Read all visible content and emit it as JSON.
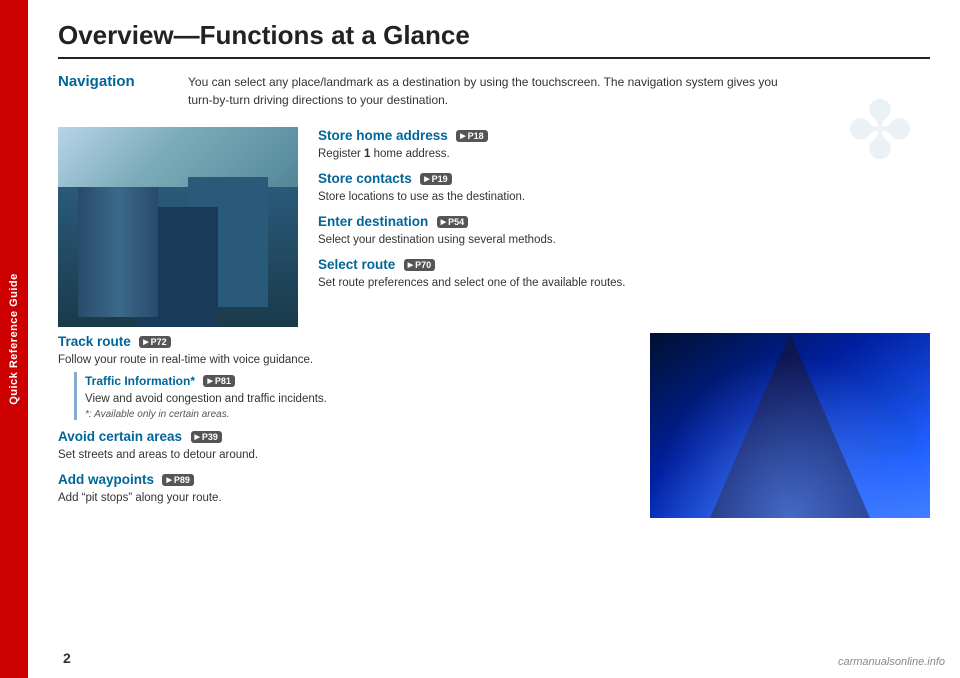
{
  "sidebar": {
    "label": "Quick Reference Guide"
  },
  "page": {
    "title": "Overview—Functions at a Glance",
    "number": "2"
  },
  "navigation": {
    "label": "Navigation",
    "description_line1": "You can select any place/landmark as a destination by using the touchscreen. The navigation system gives you",
    "description_line2": "turn-by-turn driving directions to your destination."
  },
  "features": [
    {
      "title": "Store home address",
      "page_ref": "P18",
      "description": "Register 1 home address."
    },
    {
      "title": "Store contacts",
      "page_ref": "P19",
      "description": "Store locations to use as the destination."
    },
    {
      "title": "Enter destination",
      "page_ref": "P54",
      "description": "Select your destination using several methods."
    },
    {
      "title": "Select route",
      "page_ref": "P70",
      "description": "Set route preferences and select one of the available routes."
    }
  ],
  "lower_features": [
    {
      "title": "Track route",
      "page_ref": "P72",
      "description": "Follow your route in real-time with voice guidance.",
      "sub_feature": {
        "title": "Traffic Information*",
        "page_ref": "P81",
        "description": "View and avoid congestion and traffic incidents.",
        "note": "*: Available only in certain areas."
      }
    },
    {
      "title": "Avoid certain areas",
      "page_ref": "P39",
      "description": "Set streets and areas to detour around."
    },
    {
      "title": "Add waypoints",
      "page_ref": "P89",
      "description": "Add “pit stops” along your route."
    }
  ],
  "watermark": "carmanualsonline.info"
}
